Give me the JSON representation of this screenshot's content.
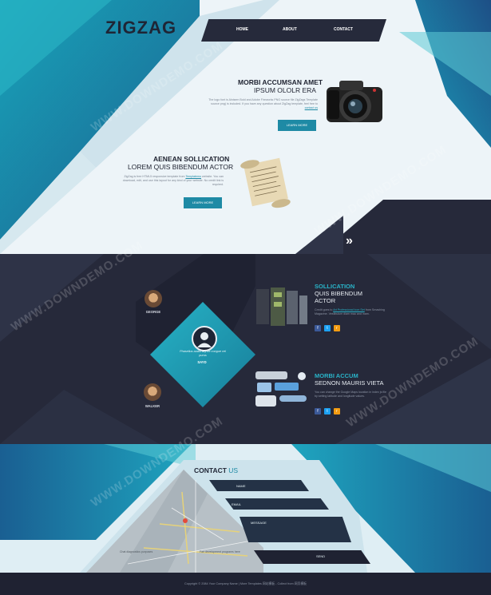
{
  "brand": {
    "logo": "ZIGZAG"
  },
  "nav": {
    "items": [
      "HOME",
      "ABOUT",
      "CONTACT"
    ]
  },
  "hero": {
    "block1": {
      "title": "MORBI ACCUMSAN AMET",
      "subtitle": "IPSUM OLOLR ERA",
      "text": "The logo font is Alnisem Bold and Adobe Fireworks PNG source file ZigZags Template source png) is included. If you have any question about ZigZag template, feel free to",
      "link": "contact us",
      "button": "LEARN MORE"
    },
    "block2": {
      "title": "AENEAN SOLLICATION",
      "subtitle": "LOREM QUIS BIBENDUM ACTOR",
      "text": "ZigZag is free HTML5 responsive template from",
      "link": "Templatemo",
      "text2": "website. You can download, edit, and use this layout for any kind of your website. No credit link is required.",
      "button": "LEARN MORE"
    },
    "next_icon": "double-chevron-right-icon"
  },
  "testimonials": {
    "people": [
      {
        "name": "GEORGE"
      },
      {
        "name": "SAYD",
        "quote": "Phasellus audio ary tet congue vel purus"
      },
      {
        "name": "WALKER"
      }
    ]
  },
  "features": [
    {
      "title": "SOLLICATION",
      "subtitle": "QUIS BIBENDUM",
      "subtitle2": "ACTOR",
      "text": "Credit goes to",
      "link": "Art Professional Icon Set",
      "text2": "from Smashing Magazine. Vestibulum diam mau and inam.",
      "icons": [
        "facebook-icon",
        "twitter-icon",
        "rss-icon"
      ]
    },
    {
      "title": "MORBI ACCUM",
      "subtitle": "SEDNON MAURIS VIETA",
      "text": "You can change the Google Maps location in index js file by setting latitude and longitude values.",
      "icons": [
        "facebook-icon",
        "twitter-icon",
        "rss-icon"
      ]
    }
  ],
  "contact": {
    "title_bold": "CONTACT",
    "title_light": "US",
    "fields": {
      "name": "NAME",
      "email": "EMAIL",
      "message": "MESSAGE"
    },
    "send": "SEND",
    "map_label_left": "Chat diagnostics purposes",
    "map_label_right": "Fair development programs here"
  },
  "footer": {
    "text": "Copyright © 2084 Your Company Name | More Templates 网站模板 - Collect from 网页模板"
  },
  "watermark": "WWW.DOWNDEMO.COM",
  "colors": {
    "dark": "#262a3b",
    "teal": "#1e8aa5",
    "accent": "#29b3c8"
  }
}
